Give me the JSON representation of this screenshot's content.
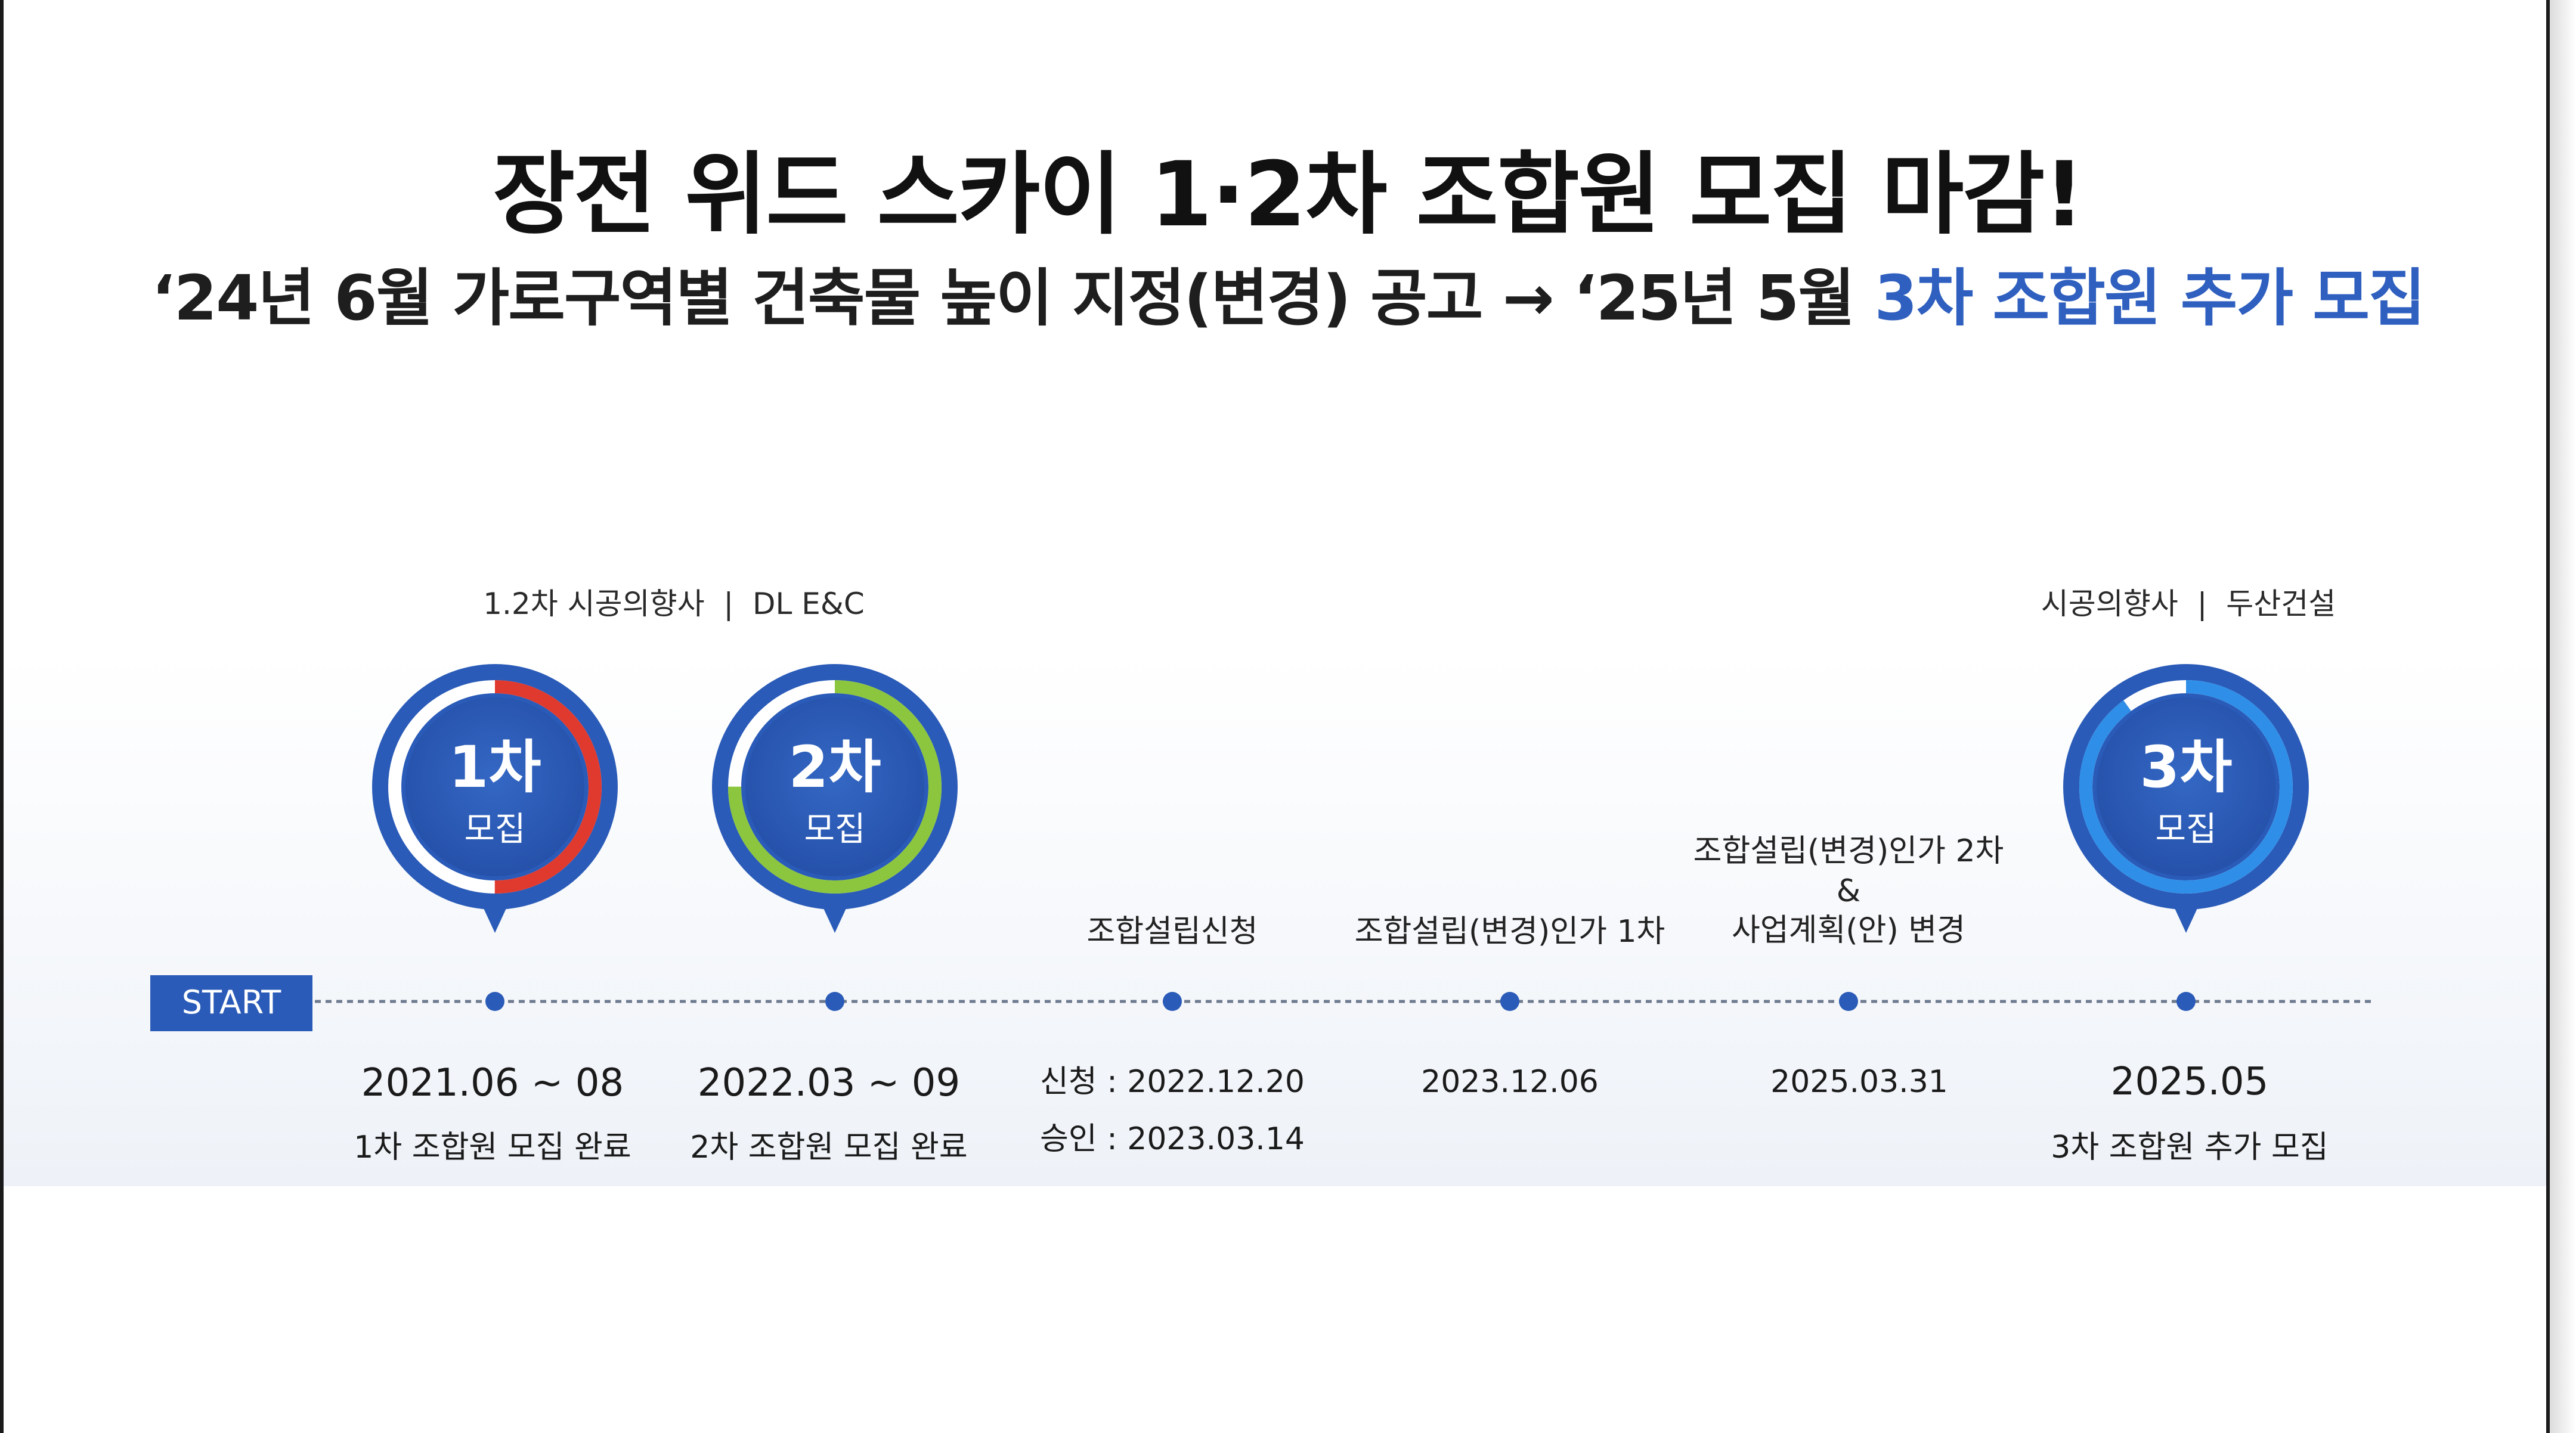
{
  "title": "장전 위드 스카이 1·2차 조합원 모집 마감!",
  "subtitle": {
    "prefix": "‘24년 6월 가로구역별 건축물 높이 지정(변경) 공고 → ‘25년 5월 ",
    "accent": "3차 조합원 추가 모집"
  },
  "start_label": "START",
  "builders": {
    "first": "1.2차 시공의향사  |  DL E&C",
    "second": "시공의향사  |  두산건설"
  },
  "badges": [
    {
      "top": "1차",
      "bottom": "모집",
      "ring_color": "#e03a2f",
      "progress": 0.5
    },
    {
      "top": "2차",
      "bottom": "모집",
      "ring_color": "#8cc63f",
      "progress": 0.75
    },
    {
      "top": "3차",
      "bottom": "모집",
      "ring_color": "#2f8fe8",
      "progress": 0.9
    }
  ],
  "events": {
    "union_application": "조합설립신청",
    "union_change_1": "조합설립(변경)인가 1차",
    "union_change_2_line1": "조합설립(변경)인가 2차",
    "union_change_2_amp": "&",
    "union_change_2_line2": "사업계획(안) 변경"
  },
  "dates": {
    "d1_date": "2021.06 ~ 08",
    "d1_desc": "1차 조합원 모집 완료",
    "d2_date": "2022.03 ~ 09",
    "d2_desc": "2차 조합원 모집 완료",
    "d3_line1": "신청 : 2022.12.20",
    "d3_line2": "승인 : 2023.03.14",
    "d4_date": "2023.12.06",
    "d5_date": "2025.03.31",
    "d6_date": "2025.05",
    "d6_desc": "3차 조합원 추가 모집"
  },
  "colors": {
    "primary_blue": "#2a5bb8",
    "accent_blue": "#2f5fbf",
    "dotted_line": "#6e7a8f"
  }
}
